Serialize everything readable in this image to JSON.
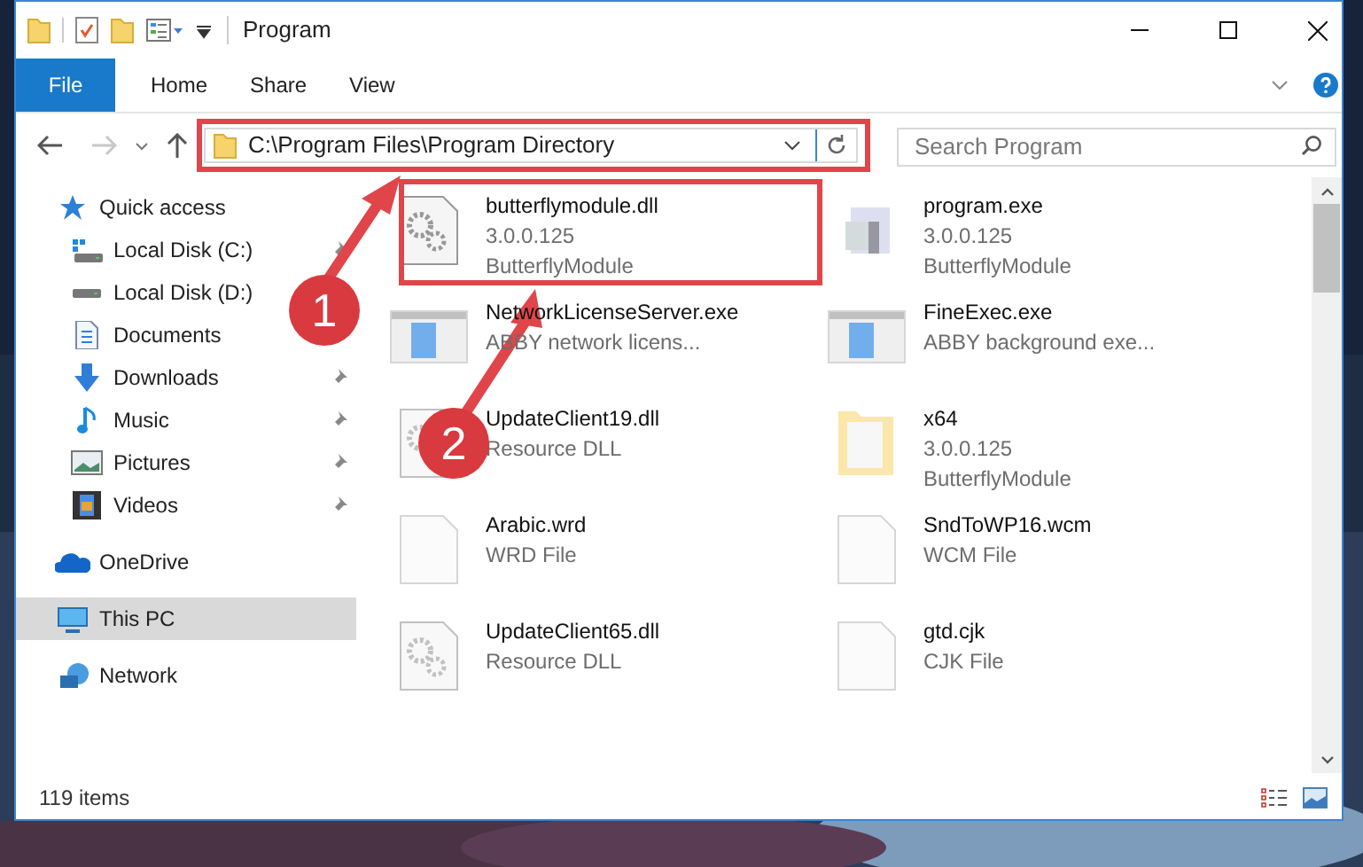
{
  "window": {
    "title": "Program"
  },
  "ribbon_tabs": [
    {
      "label": "File",
      "kind": "file",
      "selected": false
    },
    {
      "label": "Home",
      "kind": "tab",
      "selected": false
    },
    {
      "label": "Share",
      "kind": "tab",
      "selected": false
    },
    {
      "label": "View",
      "kind": "tab",
      "selected": false
    }
  ],
  "address_bar": {
    "path": "C:\\Program Files\\Program Directory"
  },
  "search": {
    "placeholder": "Search Program"
  },
  "navigation": [
    {
      "label": "Quick access",
      "kind": "star",
      "selected": false,
      "children": [
        {
          "label": "Local Disk (C:)",
          "kind": "drive-win",
          "pinned": true
        },
        {
          "label": "Local Disk (D:)",
          "kind": "drive",
          "pinned": false
        },
        {
          "label": "Documents",
          "kind": "documents",
          "pinned": false
        },
        {
          "label": "Downloads",
          "kind": "downloads",
          "pinned": true
        },
        {
          "label": "Music",
          "kind": "music",
          "pinned": true
        },
        {
          "label": "Pictures",
          "kind": "pictures",
          "pinned": true
        },
        {
          "label": "Videos",
          "kind": "videos",
          "pinned": true
        }
      ]
    },
    {
      "label": "OneDrive",
      "kind": "onedrive",
      "selected": false
    },
    {
      "label": "This PC",
      "kind": "pc",
      "selected": true
    },
    {
      "label": "Network",
      "kind": "network",
      "selected": false
    }
  ],
  "files": [
    {
      "name": "butterflymodule.dll",
      "details": [
        "3.0.0.125",
        "ButterflyModule"
      ],
      "kind": "gear-file"
    },
    {
      "name": "program.exe",
      "details": [
        "3.0.0.125",
        "ButterflyModule"
      ],
      "kind": "app"
    },
    {
      "name": "NetworkLicenseServer.exe",
      "details": [
        "ABBY network licens..."
      ],
      "kind": "window-app"
    },
    {
      "name": "FineExec.exe",
      "details": [
        "ABBY background exe..."
      ],
      "kind": "window-app"
    },
    {
      "name": "UpdateClient19.dll",
      "details": [
        "Resource DLL"
      ],
      "kind": "gear-file"
    },
    {
      "name": "x64",
      "details": [
        "3.0.0.125",
        "ButterflyModule"
      ],
      "kind": "folder"
    },
    {
      "name": "Arabic.wrd",
      "details": [
        "WRD File"
      ],
      "kind": "blank-file"
    },
    {
      "name": "SndToWP16.wcm",
      "details": [
        "WCM File"
      ],
      "kind": "blank-file"
    },
    {
      "name": "UpdateClient65.dll",
      "details": [
        "Resource DLL"
      ],
      "kind": "gear-file"
    },
    {
      "name": "gtd.cjk",
      "details": [
        "CJK File"
      ],
      "kind": "blank-file"
    }
  ],
  "status_bar": {
    "item_count": "119 items"
  },
  "annotations": [
    {
      "label": "1"
    },
    {
      "label": "2"
    }
  ]
}
